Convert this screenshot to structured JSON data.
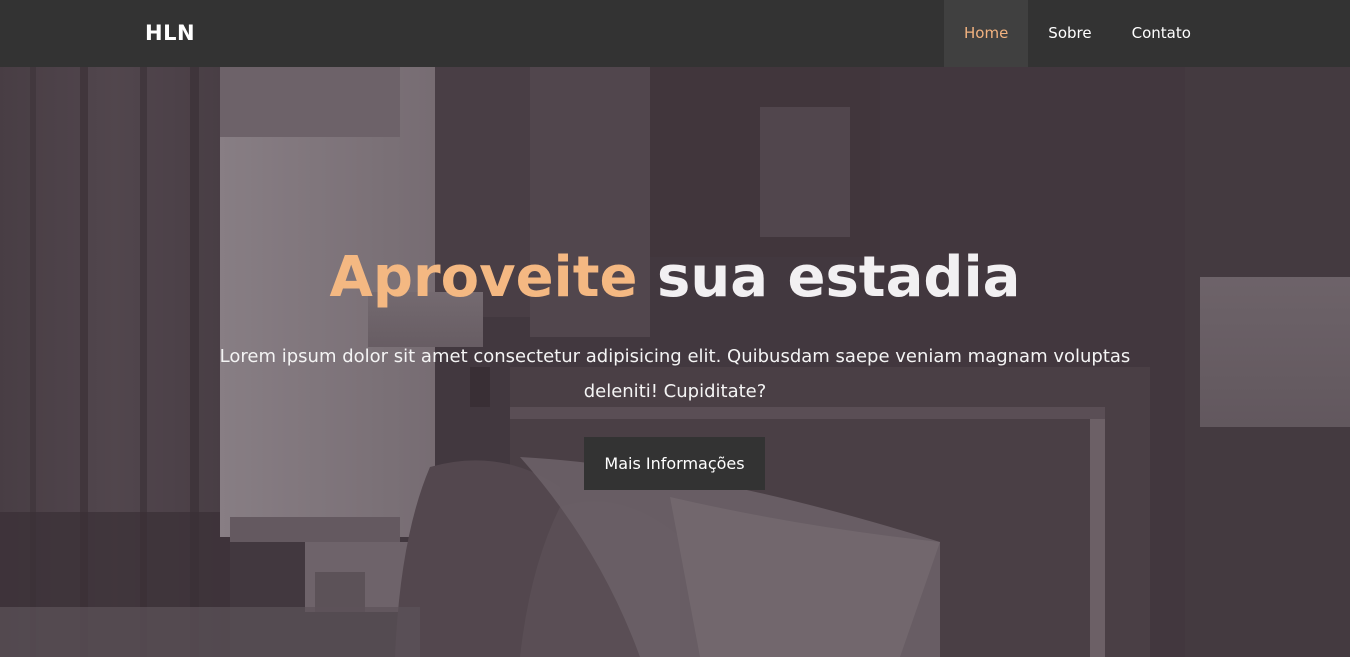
{
  "navbar": {
    "brand": "HLN",
    "items": [
      {
        "label": "Home",
        "active": true
      },
      {
        "label": "Sobre",
        "active": false
      },
      {
        "label": "Contato",
        "active": false
      }
    ]
  },
  "hero": {
    "title_accent": "Aproveite",
    "title_rest": "sua estadia",
    "subtitle": "Lorem ipsum dolor sit amet consectetur adipisicing elit. Quibusdam saepe veniam magnam voluptas deleniti! Cupiditate?",
    "button_label": "Mais Informações",
    "background_image": "hotel-bedroom-photo"
  },
  "colors": {
    "navbar_bg": "#333333",
    "active_nav_bg": "#404040",
    "accent": "#f2b27f",
    "button_bg": "#333333",
    "overlay": "#463741"
  }
}
